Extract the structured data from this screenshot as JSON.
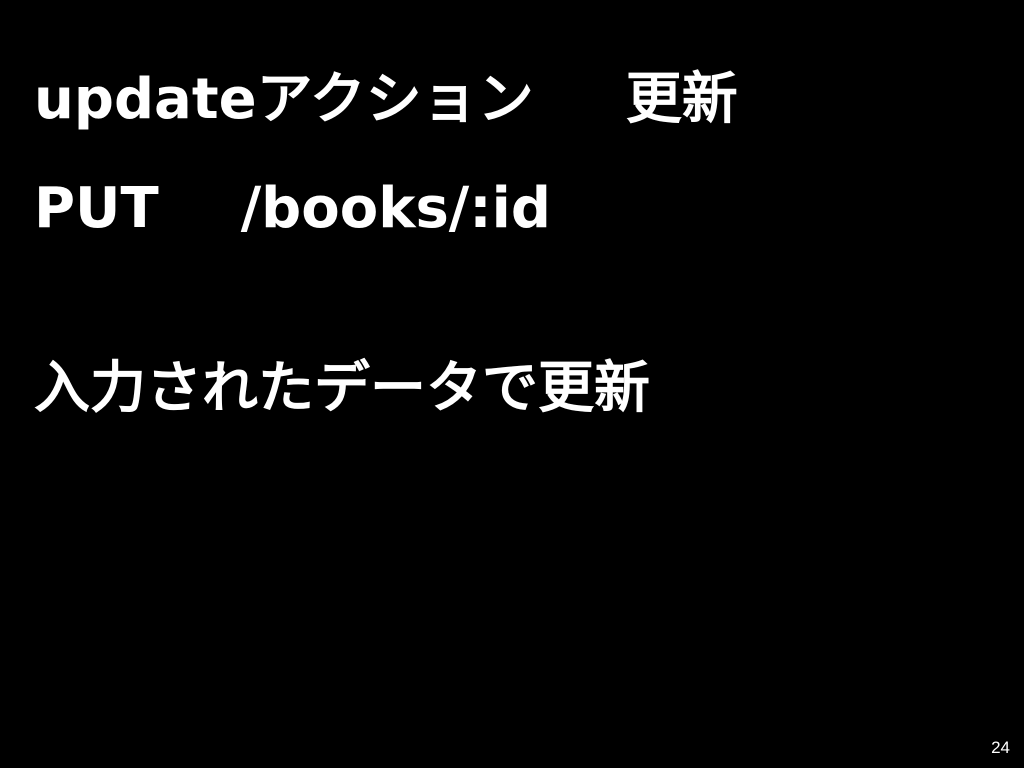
{
  "slide": {
    "line1": {
      "action": "updateアクション",
      "meaning": "更新"
    },
    "line2": {
      "method": "PUT",
      "path": "/books/:id"
    },
    "line3": {
      "description": "入力されたデータで更新"
    },
    "page_number": "24"
  },
  "colors": {
    "background": "#000000",
    "text": "#ffffff"
  }
}
